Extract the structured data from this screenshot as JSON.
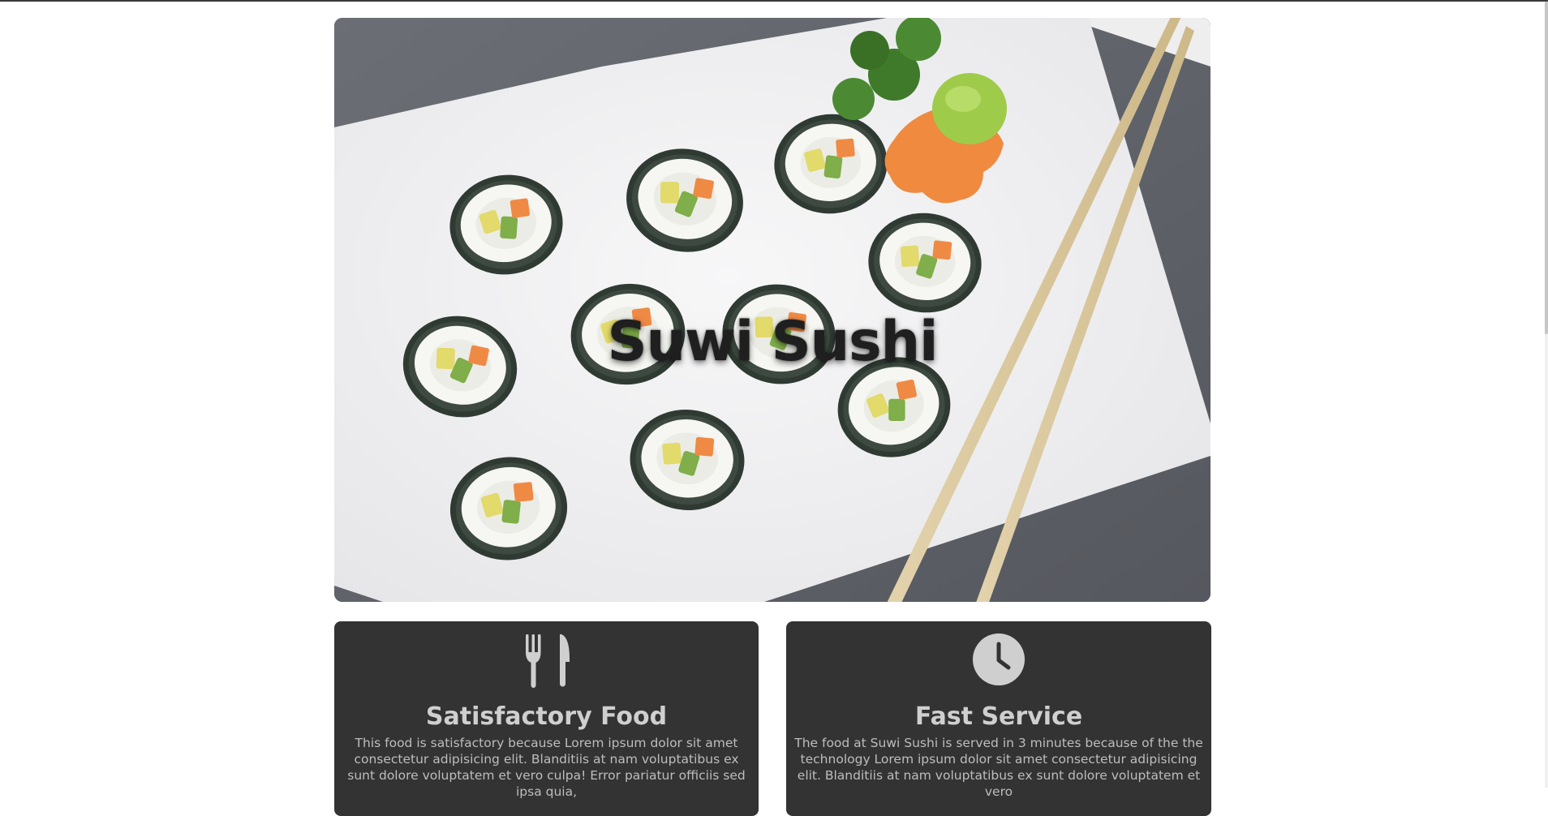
{
  "hero": {
    "title": "Suwi Sushi",
    "image_alt": "sushi rolls on a white plate with chopsticks"
  },
  "features": [
    {
      "icon": "utensils-icon",
      "title": "Satisfactory Food",
      "text": "This food is satisfactory because Lorem ipsum dolor sit amet consectetur adipisicing elit. Blanditiis at nam voluptatibus ex sunt dolore voluptatem et vero culpa! Error pariatur officiis sed ipsa quia,"
    },
    {
      "icon": "clock-icon",
      "title": "Fast Service",
      "text": "The food at Suwi Sushi is served in 3 minutes because of the the technology Lorem ipsum dolor sit amet consectetur adipisicing elit. Blanditiis at nam voluptatibus ex sunt dolore voluptatem et vero"
    }
  ],
  "colors": {
    "card_background": "#333333",
    "card_text": "#bdbdbd",
    "hero_title": "#1f1f1f"
  }
}
